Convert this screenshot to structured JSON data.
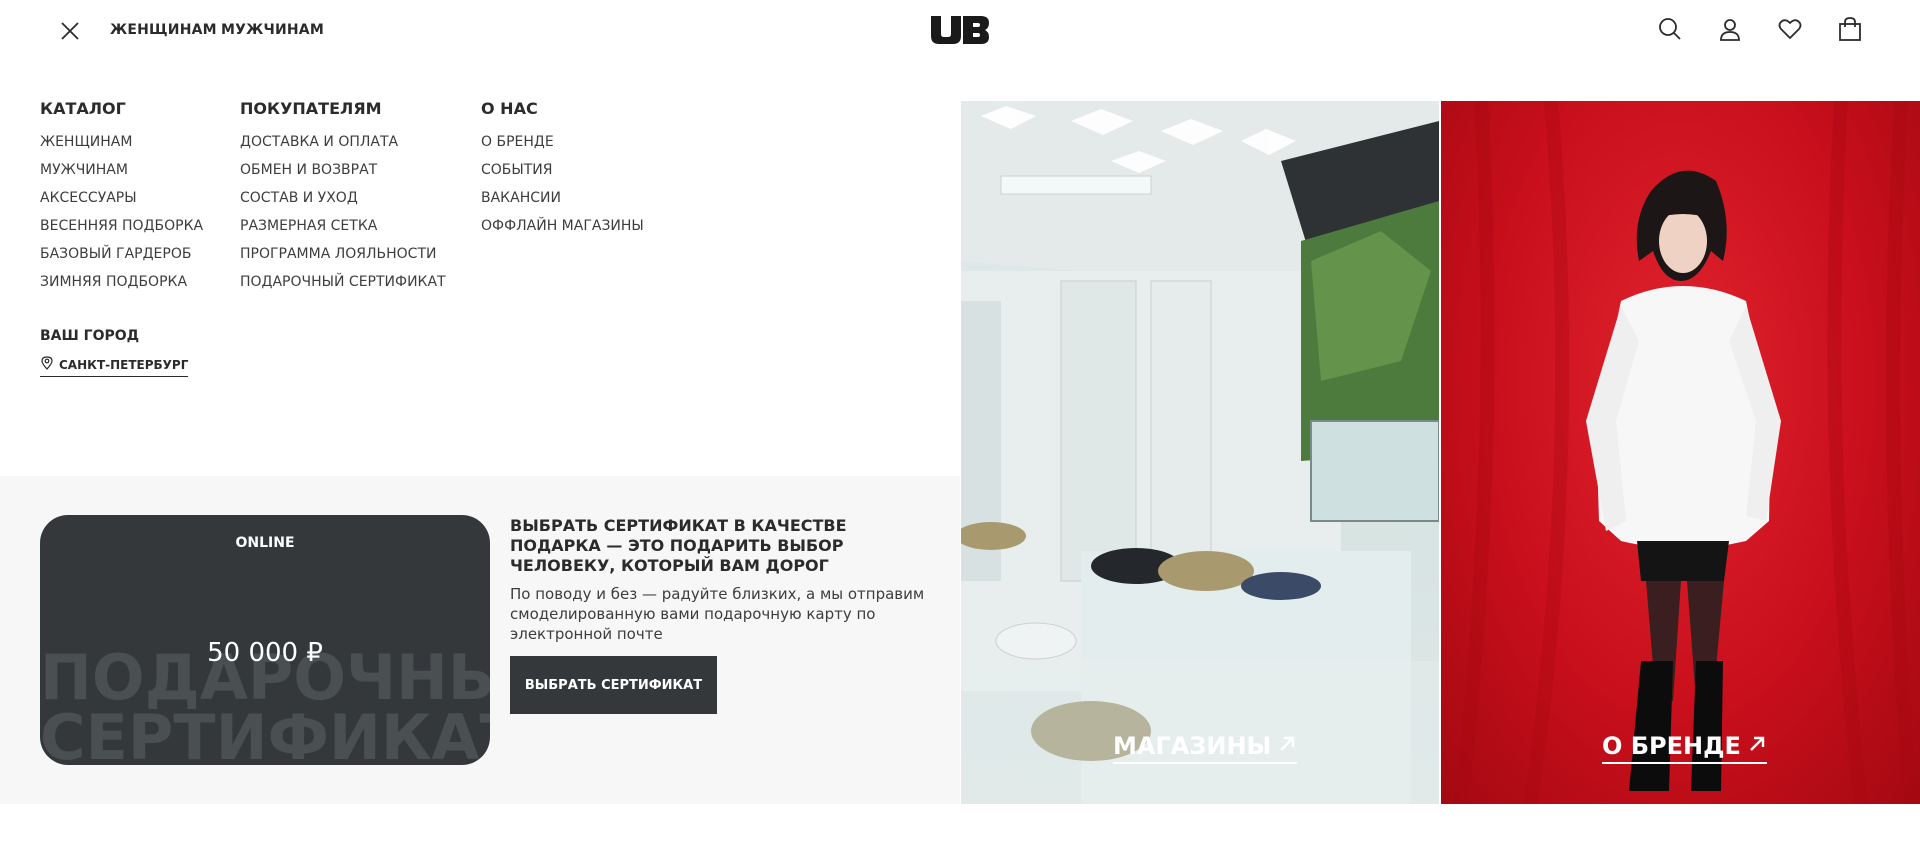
{
  "header": {
    "nav": [
      "ЖЕНЩИНАМ",
      "МУЖЧИНАМ"
    ],
    "logo_text": "UB"
  },
  "menu": {
    "catalog": {
      "title": "КАТАЛОГ",
      "items": [
        "ЖЕНЩИНАМ",
        "МУЖЧИНАМ",
        "АКСЕССУАРЫ",
        "ВЕСЕННЯЯ ПОДБОРКА",
        "БАЗОВЫЙ ГАРДЕРОБ",
        "ЗИМНЯЯ ПОДБОРКА"
      ]
    },
    "buyers": {
      "title": "ПОКУПАТЕЛЯМ",
      "items": [
        "ДОСТАВКА И ОПЛАТА",
        "ОБМЕН И ВОЗВРАТ",
        "СОСТАВ И УХОД",
        "РАЗМЕРНАЯ СЕТКА",
        "ПРОГРАММА ЛОЯЛЬНОСТИ",
        "ПОДАРОЧНЫЙ СЕРТИФИКАТ"
      ]
    },
    "about": {
      "title": "О НАС",
      "items": [
        "О БРЕНДЕ",
        "СОБЫТИЯ",
        "ВАКАНСИИ",
        "ОФФЛАЙН МАГАЗИНЫ"
      ]
    }
  },
  "city": {
    "title": "ВАШ ГОРОД",
    "value": "САНКТ-ПЕТЕРБУРГ"
  },
  "gift": {
    "card_type": "ONLINE",
    "amount": "50 000 ₽",
    "watermark_line1": "ПОДАРОЧНЫЙ",
    "watermark_line2": "СЕРТИФИКАТ",
    "heading": "ВЫБРАТЬ СЕРТИФИКАТ В КАЧЕСТВЕ ПОДАРКА — ЭТО ПОДАРИТЬ ВЫБОР ЧЕЛОВЕКУ, КОТОРЫЙ ВАМ ДОРОГ",
    "description": "По поводу и без — радуйте близких, а мы отправим смоделированную вами подарочную карту по электронной почте",
    "button": "ВЫБРАТЬ СЕРТИФИКАТ"
  },
  "promos": {
    "stores": "МАГАЗИНЫ",
    "brand": "О БРЕНДЕ"
  },
  "colors": {
    "dark": "#34383b",
    "brand_red": "#d4111e",
    "section_bg": "#f7f7f7"
  }
}
